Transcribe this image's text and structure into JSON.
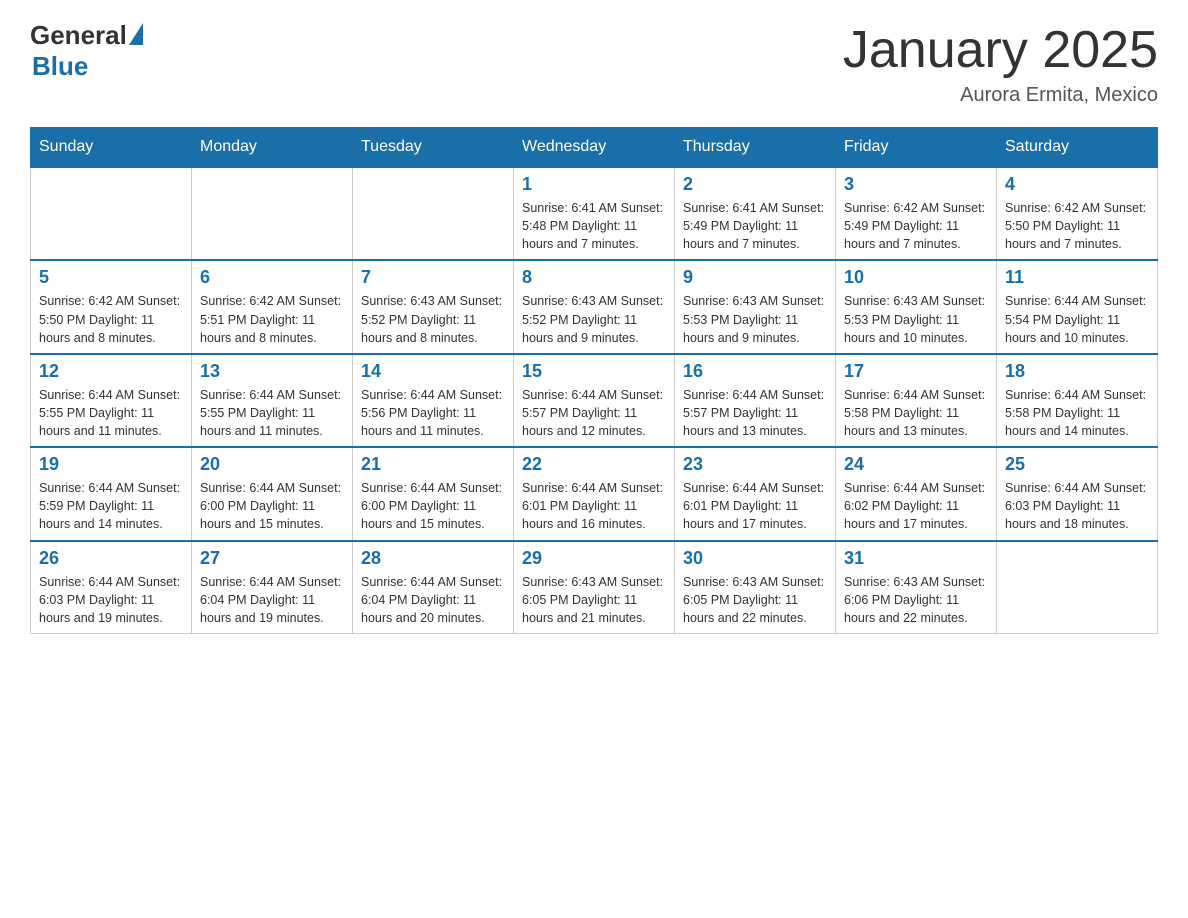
{
  "header": {
    "logo_general": "General",
    "logo_blue": "Blue",
    "month_title": "January 2025",
    "location": "Aurora Ermita, Mexico"
  },
  "days_of_week": [
    "Sunday",
    "Monday",
    "Tuesday",
    "Wednesday",
    "Thursday",
    "Friday",
    "Saturday"
  ],
  "weeks": [
    [
      {
        "day": "",
        "info": ""
      },
      {
        "day": "",
        "info": ""
      },
      {
        "day": "",
        "info": ""
      },
      {
        "day": "1",
        "info": "Sunrise: 6:41 AM\nSunset: 5:48 PM\nDaylight: 11 hours and 7 minutes."
      },
      {
        "day": "2",
        "info": "Sunrise: 6:41 AM\nSunset: 5:49 PM\nDaylight: 11 hours and 7 minutes."
      },
      {
        "day": "3",
        "info": "Sunrise: 6:42 AM\nSunset: 5:49 PM\nDaylight: 11 hours and 7 minutes."
      },
      {
        "day": "4",
        "info": "Sunrise: 6:42 AM\nSunset: 5:50 PM\nDaylight: 11 hours and 7 minutes."
      }
    ],
    [
      {
        "day": "5",
        "info": "Sunrise: 6:42 AM\nSunset: 5:50 PM\nDaylight: 11 hours and 8 minutes."
      },
      {
        "day": "6",
        "info": "Sunrise: 6:42 AM\nSunset: 5:51 PM\nDaylight: 11 hours and 8 minutes."
      },
      {
        "day": "7",
        "info": "Sunrise: 6:43 AM\nSunset: 5:52 PM\nDaylight: 11 hours and 8 minutes."
      },
      {
        "day": "8",
        "info": "Sunrise: 6:43 AM\nSunset: 5:52 PM\nDaylight: 11 hours and 9 minutes."
      },
      {
        "day": "9",
        "info": "Sunrise: 6:43 AM\nSunset: 5:53 PM\nDaylight: 11 hours and 9 minutes."
      },
      {
        "day": "10",
        "info": "Sunrise: 6:43 AM\nSunset: 5:53 PM\nDaylight: 11 hours and 10 minutes."
      },
      {
        "day": "11",
        "info": "Sunrise: 6:44 AM\nSunset: 5:54 PM\nDaylight: 11 hours and 10 minutes."
      }
    ],
    [
      {
        "day": "12",
        "info": "Sunrise: 6:44 AM\nSunset: 5:55 PM\nDaylight: 11 hours and 11 minutes."
      },
      {
        "day": "13",
        "info": "Sunrise: 6:44 AM\nSunset: 5:55 PM\nDaylight: 11 hours and 11 minutes."
      },
      {
        "day": "14",
        "info": "Sunrise: 6:44 AM\nSunset: 5:56 PM\nDaylight: 11 hours and 11 minutes."
      },
      {
        "day": "15",
        "info": "Sunrise: 6:44 AM\nSunset: 5:57 PM\nDaylight: 11 hours and 12 minutes."
      },
      {
        "day": "16",
        "info": "Sunrise: 6:44 AM\nSunset: 5:57 PM\nDaylight: 11 hours and 13 minutes."
      },
      {
        "day": "17",
        "info": "Sunrise: 6:44 AM\nSunset: 5:58 PM\nDaylight: 11 hours and 13 minutes."
      },
      {
        "day": "18",
        "info": "Sunrise: 6:44 AM\nSunset: 5:58 PM\nDaylight: 11 hours and 14 minutes."
      }
    ],
    [
      {
        "day": "19",
        "info": "Sunrise: 6:44 AM\nSunset: 5:59 PM\nDaylight: 11 hours and 14 minutes."
      },
      {
        "day": "20",
        "info": "Sunrise: 6:44 AM\nSunset: 6:00 PM\nDaylight: 11 hours and 15 minutes."
      },
      {
        "day": "21",
        "info": "Sunrise: 6:44 AM\nSunset: 6:00 PM\nDaylight: 11 hours and 15 minutes."
      },
      {
        "day": "22",
        "info": "Sunrise: 6:44 AM\nSunset: 6:01 PM\nDaylight: 11 hours and 16 minutes."
      },
      {
        "day": "23",
        "info": "Sunrise: 6:44 AM\nSunset: 6:01 PM\nDaylight: 11 hours and 17 minutes."
      },
      {
        "day": "24",
        "info": "Sunrise: 6:44 AM\nSunset: 6:02 PM\nDaylight: 11 hours and 17 minutes."
      },
      {
        "day": "25",
        "info": "Sunrise: 6:44 AM\nSunset: 6:03 PM\nDaylight: 11 hours and 18 minutes."
      }
    ],
    [
      {
        "day": "26",
        "info": "Sunrise: 6:44 AM\nSunset: 6:03 PM\nDaylight: 11 hours and 19 minutes."
      },
      {
        "day": "27",
        "info": "Sunrise: 6:44 AM\nSunset: 6:04 PM\nDaylight: 11 hours and 19 minutes."
      },
      {
        "day": "28",
        "info": "Sunrise: 6:44 AM\nSunset: 6:04 PM\nDaylight: 11 hours and 20 minutes."
      },
      {
        "day": "29",
        "info": "Sunrise: 6:43 AM\nSunset: 6:05 PM\nDaylight: 11 hours and 21 minutes."
      },
      {
        "day": "30",
        "info": "Sunrise: 6:43 AM\nSunset: 6:05 PM\nDaylight: 11 hours and 22 minutes."
      },
      {
        "day": "31",
        "info": "Sunrise: 6:43 AM\nSunset: 6:06 PM\nDaylight: 11 hours and 22 minutes."
      },
      {
        "day": "",
        "info": ""
      }
    ]
  ]
}
